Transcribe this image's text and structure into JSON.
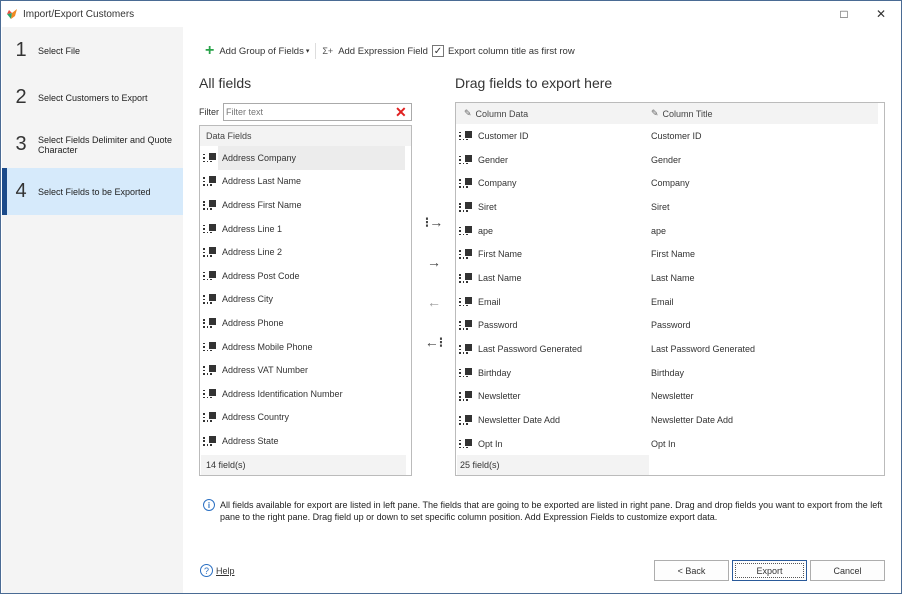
{
  "window": {
    "title": "Import/Export Customers",
    "maximize_icon": "□",
    "close_icon": "✕"
  },
  "steps": [
    {
      "number": "1",
      "label": "Select File",
      "active": false
    },
    {
      "number": "2",
      "label": "Select Customers to Export",
      "active": false
    },
    {
      "number": "3",
      "label": "Select Fields Delimiter and Quote Character",
      "active": false
    },
    {
      "number": "4",
      "label": "Select Fields to be Exported",
      "active": true
    }
  ],
  "toolbar": {
    "add_group_label": "Add Group of Fields",
    "add_group_icon": "+",
    "dropdown_icon": "▾",
    "add_expression_label": "Add Expression Field",
    "expression_icon": "Σ+",
    "export_title_checkbox_label": "Export column title as first row",
    "export_title_checked": true
  },
  "left_pane": {
    "heading": "All fields",
    "filter_label": "Filter",
    "filter_placeholder": "Filter text",
    "filter_value": "",
    "clear_icon": "✕",
    "list_header": "Data Fields",
    "items": [
      "Address Company",
      "Address Last Name",
      "Address First Name",
      "Address Line 1",
      "Address Line 2",
      "Address Post Code",
      "Address City",
      "Address Phone",
      "Address Mobile Phone",
      "Address VAT Number",
      "Address Identification Number",
      "Address Country",
      "Address State"
    ],
    "selected_index": 0,
    "footer": "14 field(s)"
  },
  "transfer_buttons": {
    "add_all": "⁝→",
    "add_one": "→",
    "remove_one": "←",
    "remove_all": "←⁝"
  },
  "right_pane": {
    "heading": "Drag fields to export here",
    "col_data_header": "Column Data",
    "col_title_header": "Column Title",
    "rows": [
      {
        "data": "Customer ID",
        "title": "Customer ID"
      },
      {
        "data": "Gender",
        "title": "Gender"
      },
      {
        "data": "Company",
        "title": "Company"
      },
      {
        "data": "Siret",
        "title": "Siret"
      },
      {
        "data": "ape",
        "title": "ape"
      },
      {
        "data": "First Name",
        "title": "First Name"
      },
      {
        "data": "Last Name",
        "title": "Last Name"
      },
      {
        "data": "Email",
        "title": "Email"
      },
      {
        "data": "Password",
        "title": "Password"
      },
      {
        "data": "Last Password Generated",
        "title": "Last Password Generated"
      },
      {
        "data": "Birthday",
        "title": "Birthday"
      },
      {
        "data": "Newsletter",
        "title": "Newsletter"
      },
      {
        "data": "Newsletter Date Add",
        "title": "Newsletter Date Add"
      },
      {
        "data": "Opt In",
        "title": "Opt In"
      }
    ],
    "footer": "25 field(s)"
  },
  "info_text": "All fields available for export are listed in left pane. The fields that are going to be exported are listed in right pane. Drag and drop fields you want to export from the left pane to the right pane. Drag field up or down to set specific column position. Add Expression Fields to customize export data.",
  "footer": {
    "help_label": "Help",
    "back_label": "< Back",
    "export_label": "Export",
    "cancel_label": "Cancel"
  }
}
